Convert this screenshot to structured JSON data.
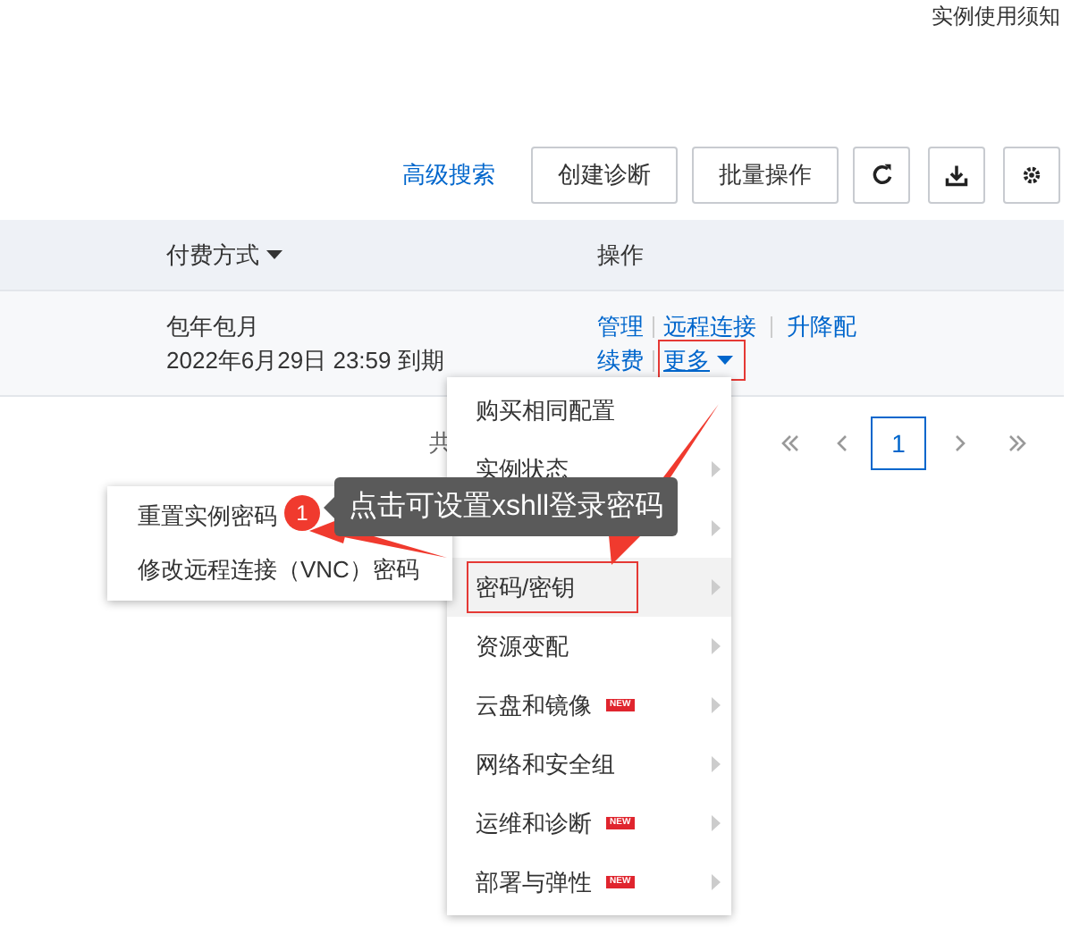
{
  "top_link": "实例使用须知",
  "toolbar": {
    "link": "高级搜索",
    "buttons": [
      "创建诊断",
      "批量操作"
    ]
  },
  "table": {
    "columns": [
      {
        "label": "付费方式",
        "sortable": true
      },
      {
        "label": "操作",
        "sortable": false
      }
    ],
    "rows": [
      {
        "billing": "包年包月",
        "expiry": "2022年6月29日 23:59 到期",
        "actions": [
          "管理",
          "远程连接",
          "升降配",
          "续费"
        ],
        "more": "更多"
      }
    ]
  },
  "pagination": {
    "total_prefix": "共",
    "pages": [
      {
        "label": "1",
        "selected": true
      }
    ]
  },
  "more_menu": {
    "items": [
      {
        "label": "购买相同配置",
        "submenu": false,
        "hovered": false
      },
      {
        "label": "实例状态",
        "submenu": true,
        "hovered": false
      },
      {
        "submenu": true,
        "hovered": false
      },
      {
        "label": "密码/密钥",
        "submenu": true,
        "hovered": true
      },
      {
        "label": "资源变配",
        "submenu": true,
        "hovered": false
      },
      {
        "label": "云盘和镜像",
        "submenu": true,
        "new_tag": "NEW",
        "hovered": false
      },
      {
        "label": "网络和安全组",
        "submenu": true,
        "hovered": false
      },
      {
        "label": "运维和诊断",
        "submenu": true,
        "new_tag": "NEW",
        "hovered": false
      },
      {
        "label": "部署与弹性",
        "submenu": true,
        "new_tag": "NEW",
        "hovered": false
      }
    ]
  },
  "submenu": {
    "items": [
      "重置实例密码",
      "修改远程连接（VNC）密码"
    ]
  },
  "annotation": {
    "number": "1",
    "text": "点击可设置xshll登录密码"
  }
}
